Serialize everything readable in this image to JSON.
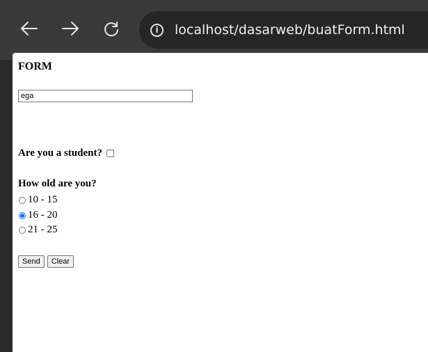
{
  "browser": {
    "url": "localhost/dasarweb/buatForm.html"
  },
  "form": {
    "title": "FORM",
    "name_value": "ega",
    "student_question": "Are you a student?",
    "student_checked": false,
    "age_question": "How old are you?",
    "age_options": [
      {
        "label": "10 - 15",
        "checked": false
      },
      {
        "label": "16 - 20",
        "checked": true
      },
      {
        "label": "21 - 25",
        "checked": false
      }
    ],
    "send_label": "Send",
    "clear_label": "Clear"
  }
}
